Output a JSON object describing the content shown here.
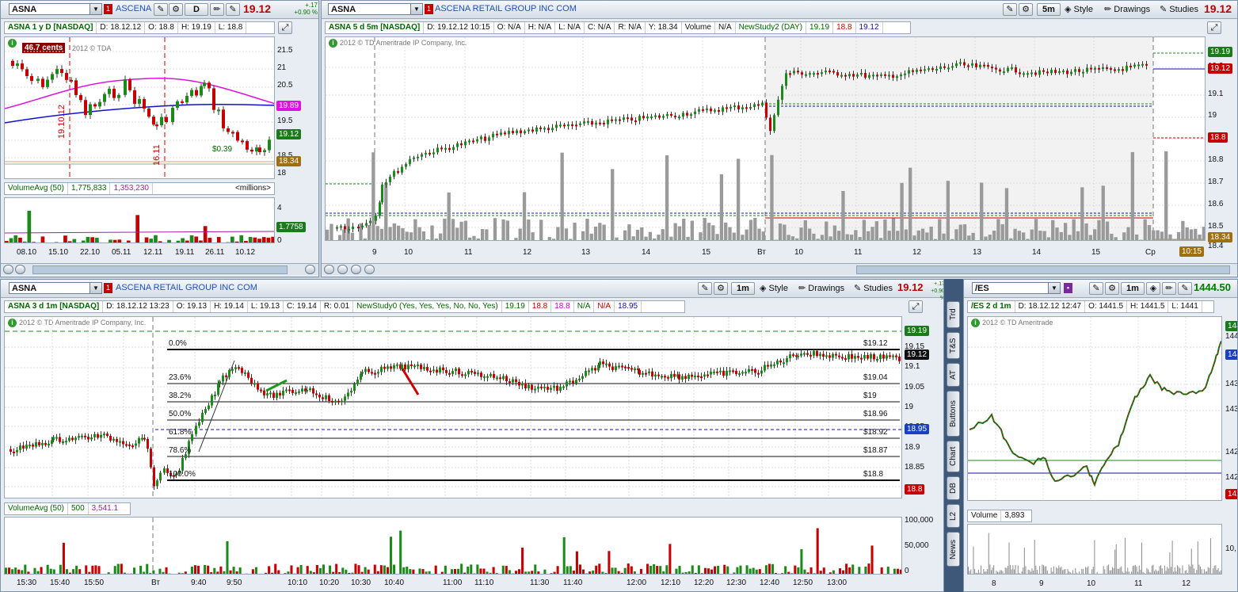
{
  "top_left": {
    "symbol": "ASNA",
    "company": "ASCENA",
    "aggregation_button": "D",
    "price": "19.12",
    "change": "+.17",
    "change_pct": "+0.90 %",
    "info": {
      "title": "ASNA 1 y D [NASDAQ]",
      "date": "D: 18.12.12",
      "open": "O: 18.8",
      "high": "H: 19.19",
      "low": "L: 18.8"
    },
    "copyright": "2012 © TDA",
    "note_box": "46.7 cents",
    "vline_labels": [
      "19.10.12",
      "16.11"
    ],
    "annotation": "$0.39",
    "y_ticks": [
      "21.5",
      "21",
      "20.5",
      "20",
      "19.5",
      "19",
      "18.5",
      "18"
    ],
    "price_tags": {
      "ma": "19.89",
      "last": "19.12",
      "low": "18.34"
    },
    "x_ticks": [
      "08.10",
      "15.10",
      "22.10",
      "05.11",
      "12.11",
      "19.11",
      "26.11",
      "10.12"
    ],
    "volume": {
      "label": "VolumeAvg (50)",
      "v1": "1,775,833",
      "v2": "1,353,230",
      "units": "<millions>",
      "y_ticks": [
        "4",
        "2",
        "0"
      ],
      "tag": "1.7758"
    }
  },
  "top_right": {
    "symbol": "ASNA",
    "company": "ASCENA RETAIL GROUP INC COM",
    "aggregation_button": "5m",
    "style": "Style",
    "drawings": "Drawings",
    "studies": "Studies",
    "price": "19.12",
    "info": [
      "ASNA 5 d 5m [NASDAQ]",
      "D: 19.12.12 10:15",
      "O: N/A",
      "H: N/A",
      "L: N/A",
      "C: N/A",
      "R: N/A",
      "Y: 18.34",
      "Volume",
      "N/A",
      "NewStudy2 (DAY)",
      "19.19",
      "18.8",
      "19.12"
    ],
    "copyright": "2012 © TD Ameritrade IP Company, Inc.",
    "y_ticks": [
      "19.2",
      "19.1",
      "19",
      "18.9",
      "18.8",
      "18.7",
      "18.6",
      "18.5",
      "18.4"
    ],
    "price_tags": {
      "high": "19.19",
      "last": "19.12",
      "low": "18.8",
      "prev": "18.34"
    },
    "x_ticks": [
      "9",
      "10",
      "11",
      "12",
      "13",
      "14",
      "15",
      "Вт",
      "10",
      "11",
      "12",
      "13",
      "14",
      "15",
      "Ср"
    ],
    "time_tag": "10:15"
  },
  "bottom_left": {
    "symbol": "ASNA",
    "company": "ASCENA RETAIL GROUP INC COM",
    "aggregation_button": "1m",
    "style": "Style",
    "drawings": "Drawings",
    "studies": "Studies",
    "price": "19.12",
    "change": "+.17",
    "change_pct": "+0.90 %",
    "info": [
      "ASNA 3 d 1m [NASDAQ]",
      "D: 18.12.12 13:23",
      "O: 19.13",
      "H: 19.14",
      "L: 19.13",
      "C: 19.14",
      "R: 0.01",
      "NewStudy0 (Yes, Yes, Yes, No, No, Yes)",
      "19.19",
      "18.8",
      "18.8",
      "N/A",
      "N/A",
      "18.95"
    ],
    "copyright": "2012 © TD Ameritrade IP Company, Inc.",
    "fib": [
      {
        "pct": "0.0%",
        "price": "$19.12"
      },
      {
        "pct": "23.6%",
        "price": "$19.04"
      },
      {
        "pct": "38.2%",
        "price": "$19"
      },
      {
        "pct": "50.0%",
        "price": "$18.96"
      },
      {
        "pct": "61.8%",
        "price": "$18.92"
      },
      {
        "pct": "78.6%",
        "price": "$18.87"
      },
      {
        "pct": "100.0%",
        "price": "$18.8"
      }
    ],
    "y_ticks": [
      "19.15",
      "19.1",
      "19.05",
      "19",
      "18.95",
      "18.9",
      "18.85"
    ],
    "price_tags": {
      "high": "19.19",
      "last": "19.12",
      "mid": "18.95",
      "low": "18.8"
    },
    "x_ticks": [
      "15:30",
      "15:40",
      "15:50",
      "Вт",
      "9:40",
      "9:50",
      "10:10",
      "10:20",
      "10:30",
      "10:40",
      "11:00",
      "11:10",
      "11:30",
      "11:40",
      "12:00",
      "12:10",
      "12:20",
      "12:30",
      "12:40",
      "12:50",
      "13:00"
    ],
    "volume": {
      "label": "VolumeAvg (50)",
      "v1": "500",
      "v2": "3,541.1",
      "y_ticks": [
        "100,000",
        "50,000",
        "0"
      ]
    }
  },
  "side_tabs": [
    "Trd",
    "T&S",
    "AT",
    "Buttons",
    "Chart",
    "DB",
    "L2",
    "News"
  ],
  "bottom_right": {
    "symbol": "/ES",
    "aggregation_button": "1m",
    "price": "1444.50",
    "info": [
      "/ES 2 d 1m",
      "D: 18.12.12 12:47",
      "O: 1441.5",
      "H: 1441.5",
      "L: 1441"
    ],
    "copyright": "2012 © TD Ameritrade",
    "y_ticks": [
      "144",
      "143",
      "143",
      "142",
      "142"
    ],
    "tags": [
      "144",
      "144",
      "142"
    ],
    "x_ticks": [
      "8",
      "9",
      "10",
      "11",
      "12"
    ],
    "volume": {
      "label": "Volume",
      "value": "3,893",
      "y_ticks": [
        "10,"
      ]
    }
  }
}
